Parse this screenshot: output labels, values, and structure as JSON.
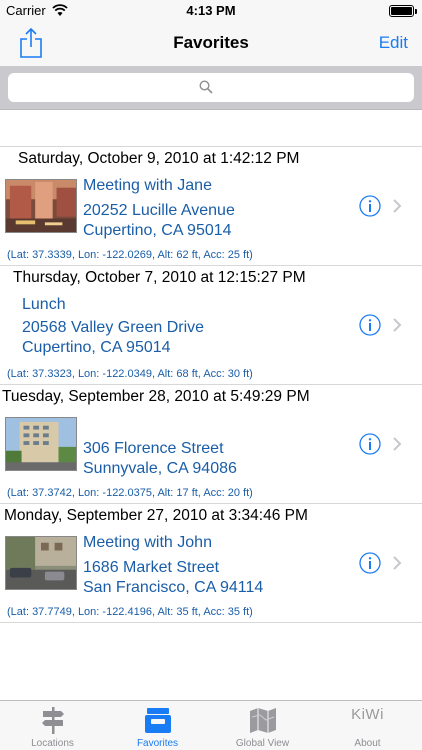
{
  "status_bar": {
    "carrier": "Carrier",
    "time": "4:13 PM"
  },
  "nav_bar": {
    "title": "Favorites",
    "edit_label": "Edit",
    "share_icon": "share-icon"
  },
  "search": {
    "placeholder": "",
    "value": ""
  },
  "entries": [
    {
      "datetime": "Saturday, October 9, 2010 at 1:42:12 PM",
      "name": "Meeting with Jane",
      "address_line1": "20252 Lucille Avenue",
      "address_line2": "Cupertino, CA 95014",
      "coords": "(Lat: 37.3339, Lon: -122.0269, Alt: 62 ft, Acc: 25 ft)",
      "has_photo": true
    },
    {
      "datetime": "Thursday, October 7, 2010 at 12:15:27 PM",
      "name": "Lunch",
      "address_line1": "20568 Valley Green Drive",
      "address_line2": "Cupertino, CA 95014",
      "coords": "(Lat: 37.3323, Lon: -122.0349, Alt: 68 ft, Acc: 30 ft)",
      "has_photo": false
    },
    {
      "datetime": "Tuesday, September 28, 2010 at 5:49:29 PM",
      "name": "",
      "address_line1": "306 Florence Street",
      "address_line2": "Sunnyvale, CA 94086",
      "coords": "(Lat: 37.3742, Lon: -122.0375, Alt: 17 ft, Acc: 20 ft)",
      "has_photo": true
    },
    {
      "datetime": "Monday, September 27, 2010 at 3:34:46 PM",
      "name": "Meeting with John",
      "address_line1": "1686 Market Street",
      "address_line2": "San Francisco, CA 94114",
      "coords": "(Lat: 37.7749, Lon: -122.4196, Alt: 35 ft, Acc: 35 ft)",
      "has_photo": true
    }
  ],
  "tab_bar": {
    "tabs": [
      {
        "label": "Locations",
        "icon": "signpost-icon",
        "active": false
      },
      {
        "label": "Favorites",
        "icon": "inbox-tray-icon",
        "active": true
      },
      {
        "label": "Global View",
        "icon": "map-icon",
        "active": false
      },
      {
        "label": "About",
        "icon": "kiwi-logo",
        "logo_text": "KiWi",
        "active": false
      }
    ]
  },
  "colors": {
    "accent": "#1a7cf4",
    "link_text": "#1a5ea8",
    "bar_bg": "#f7f7f7",
    "search_bg": "#c9c9ce"
  }
}
